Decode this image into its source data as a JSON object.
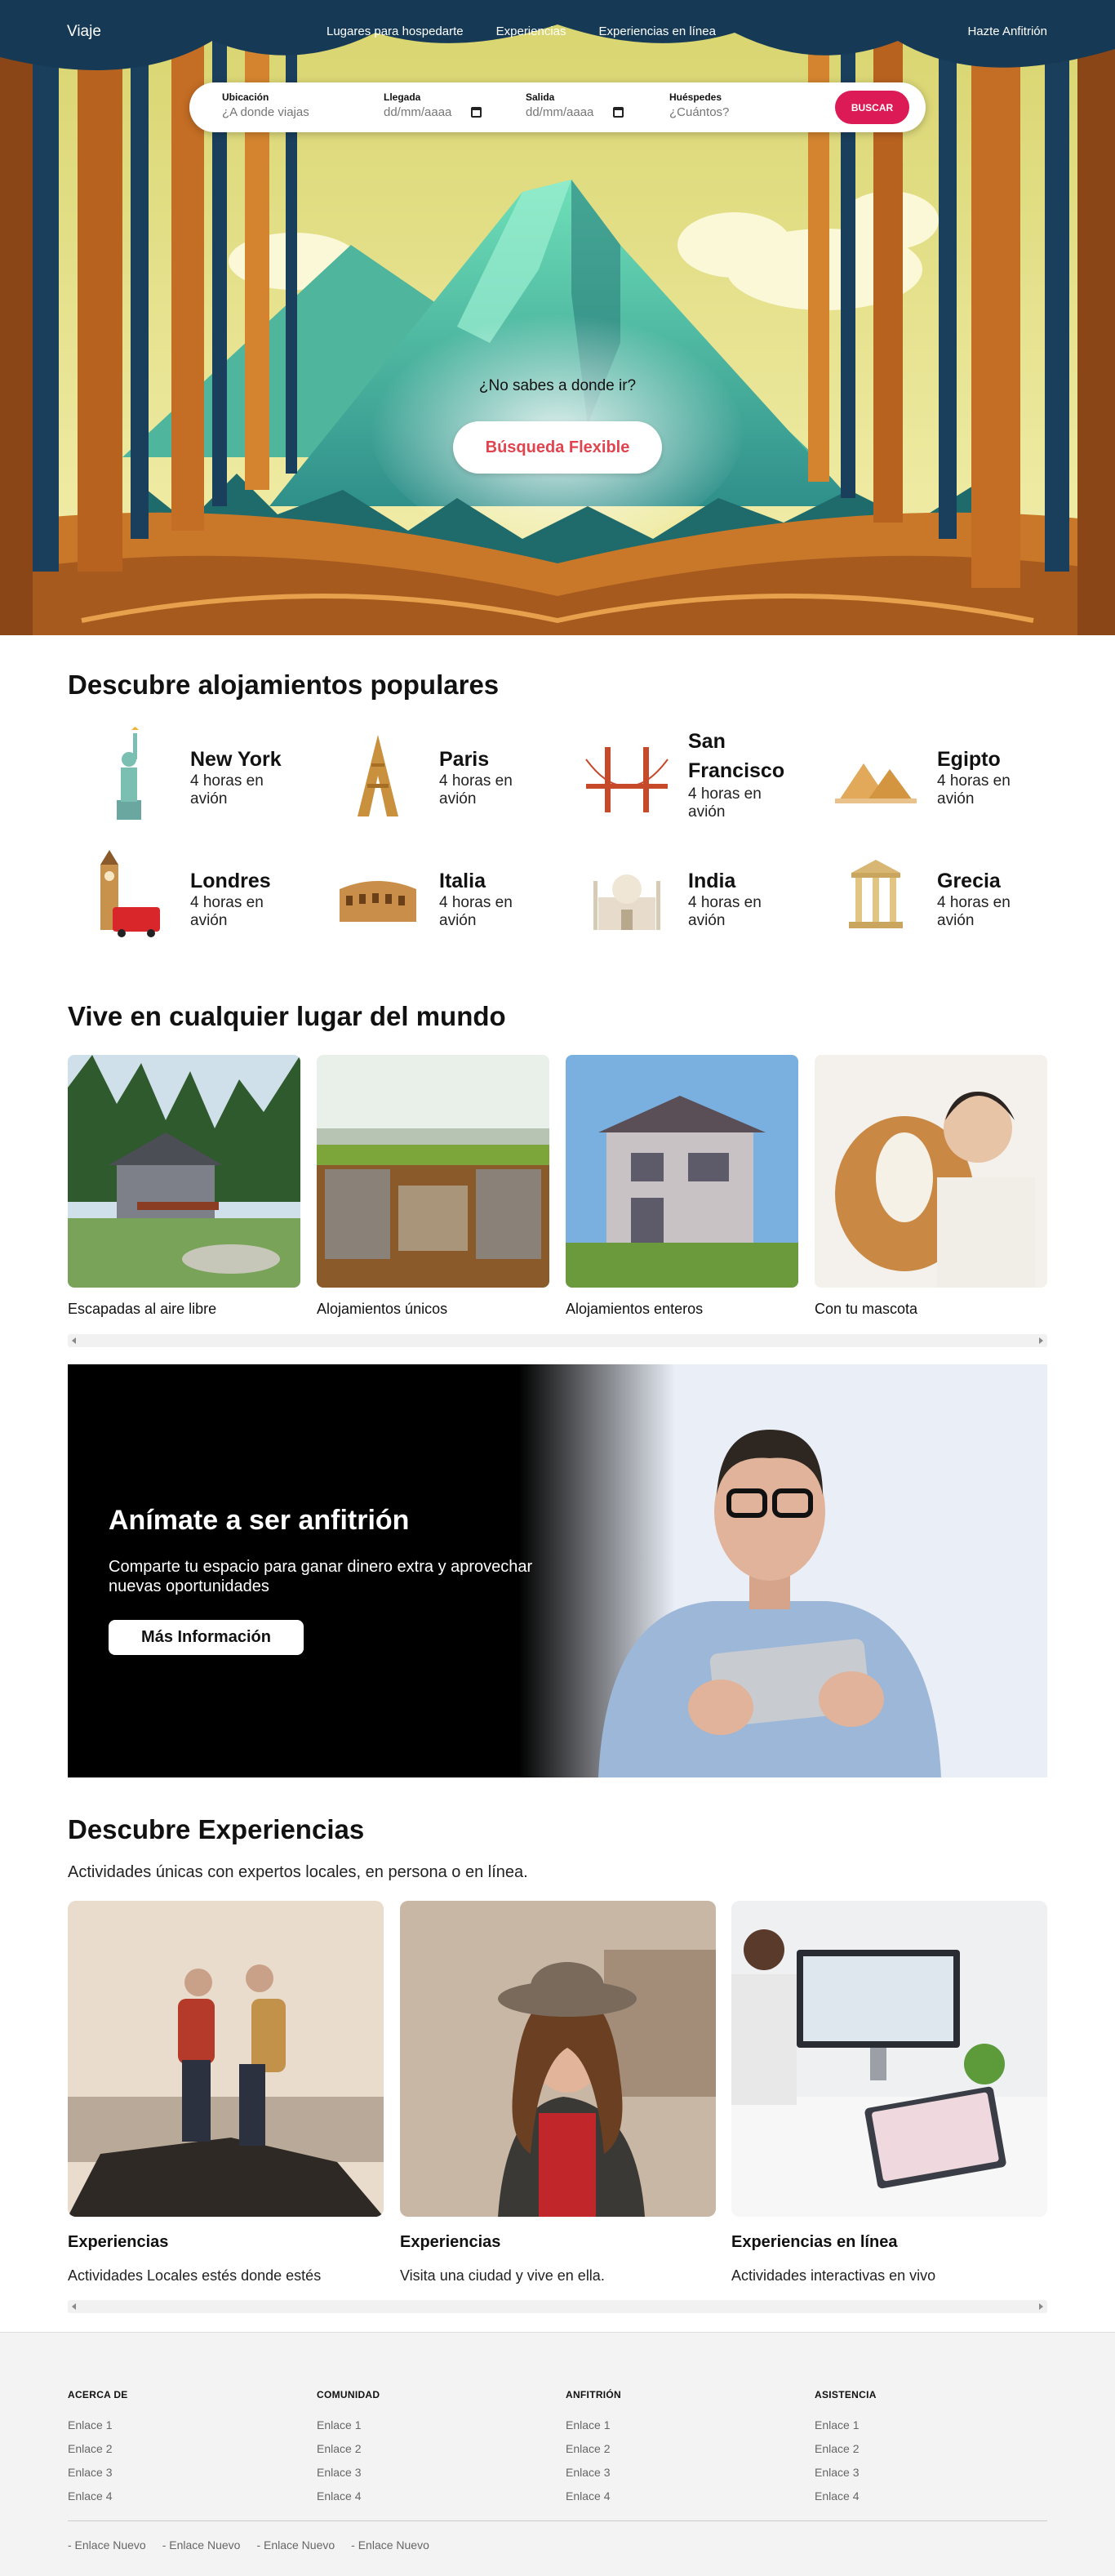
{
  "nav": {
    "logo": "Viaje",
    "links": [
      "Lugares para hospedarte",
      "Experiencias",
      "Experiencias en línea"
    ],
    "host": "Hazte Anfitrión"
  },
  "search": {
    "location_label": "Ubicación",
    "location_placeholder": "¿A donde viajas",
    "checkin_label": "Llegada",
    "checkin_value": "dd/mm/aaaa",
    "checkout_label": "Salida",
    "checkout_value": "dd/mm/aaaa",
    "guests_label": "Huéspedes",
    "guests_placeholder": "¿Cuántos?",
    "button": "BUSCAR"
  },
  "hero": {
    "question": "¿No sabes a donde ir?",
    "flex_button": "Búsqueda Flexible"
  },
  "popular": {
    "title": "Descubre alojamientos populares",
    "items": [
      {
        "name": "New York",
        "time": "4 horas en avión"
      },
      {
        "name": "Paris",
        "time": "4 horas en avión"
      },
      {
        "name": "San Francisco",
        "time": "4 horas en avión"
      },
      {
        "name": "Egipto",
        "time": "4 horas en avión"
      },
      {
        "name": "Londres",
        "time": "4 horas en avión"
      },
      {
        "name": "Italia",
        "time": "4 horas en avión"
      },
      {
        "name": "India",
        "time": "4 horas en avión"
      },
      {
        "name": "Grecia",
        "time": "4 horas en avión"
      }
    ]
  },
  "live": {
    "title": "Vive en cualquier lugar del mundo",
    "items": [
      {
        "label": "Escapadas al aire libre"
      },
      {
        "label": "Alojamientos únicos"
      },
      {
        "label": "Alojamientos enteros"
      },
      {
        "label": "Con tu mascota"
      }
    ]
  },
  "host_banner": {
    "title": "Anímate a ser anfitrión",
    "text": "Comparte tu espacio para ganar dinero extra y aprovechar nuevas oportunidades",
    "button": "Más Información"
  },
  "experiences": {
    "title": "Descubre Experiencias",
    "subtitle": "Actividades únicas con expertos locales, en persona o en línea.",
    "items": [
      {
        "title": "Experiencias",
        "desc": "Actividades Locales estés donde estés"
      },
      {
        "title": "Experiencias",
        "desc": "Visita una ciudad y vive en ella."
      },
      {
        "title": "Experiencias en línea",
        "desc": "Actividades interactivas en vivo"
      }
    ]
  },
  "footer": {
    "columns": [
      {
        "heading": "ACERCA DE",
        "links": [
          "Enlace 1",
          "Enlace 2",
          "Enlace 3",
          "Enlace 4"
        ]
      },
      {
        "heading": "COMUNIDAD",
        "links": [
          "Enlace 1",
          "Enlace 2",
          "Enlace 3",
          "Enlace 4"
        ]
      },
      {
        "heading": "ANFITRIÓN",
        "links": [
          "Enlace 1",
          "Enlace 2",
          "Enlace 3",
          "Enlace 4"
        ]
      },
      {
        "heading": "ASISTENCIA",
        "links": [
          "Enlace 1",
          "Enlace 2",
          "Enlace 3",
          "Enlace 4"
        ]
      }
    ],
    "bottom_links": [
      "-  Enlace Nuevo",
      "-  Enlace Nuevo",
      "-  Enlace Nuevo",
      "-  Enlace Nuevo"
    ]
  },
  "colors": {
    "accent": "#dc1a55",
    "flex_text": "#e1444f",
    "footer_bg": "#f3f3f3"
  }
}
